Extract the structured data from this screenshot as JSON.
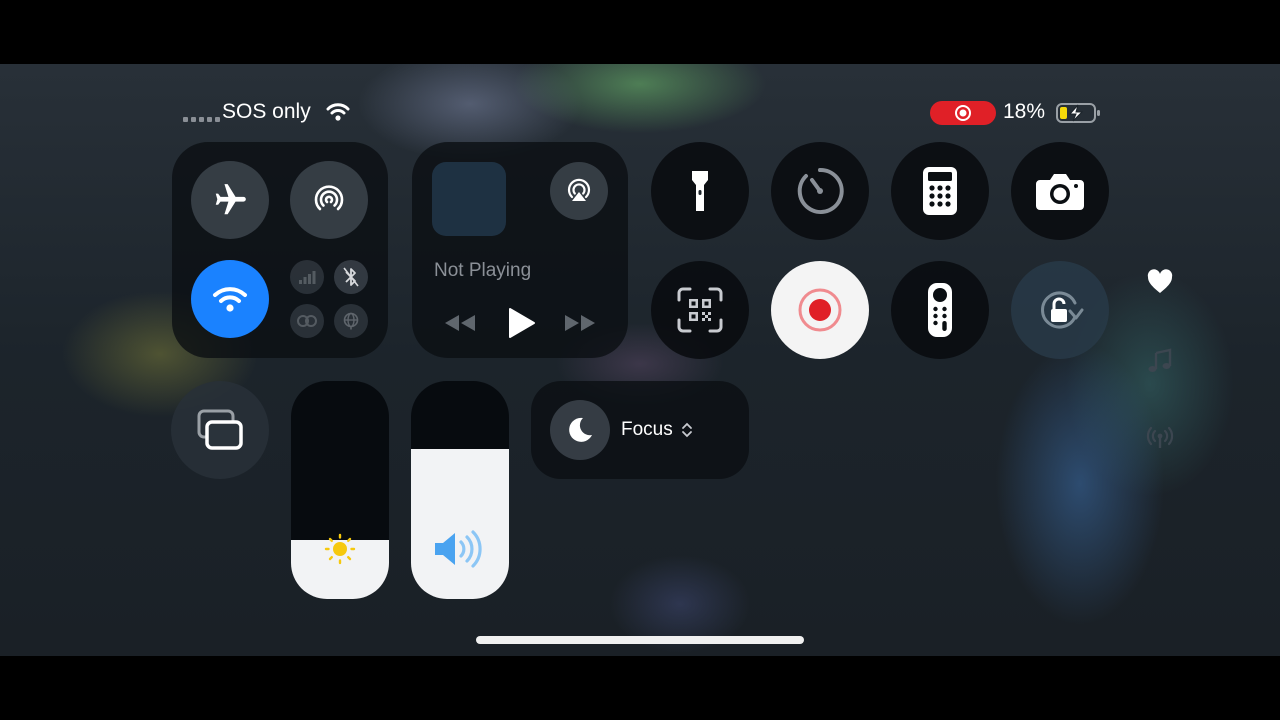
{
  "status_bar": {
    "carrier": "SOS only",
    "battery_percent": "18%",
    "battery_level": 0.18,
    "recording_active": true
  },
  "connectivity": {
    "airplane_mode": false,
    "airdrop": false,
    "wifi": true,
    "cellular": false,
    "bluetooth": false,
    "personal_hotspot": false,
    "vpn": false
  },
  "media": {
    "now_playing": "Not Playing"
  },
  "focus": {
    "label": "Focus"
  },
  "brightness_level": 0.27,
  "volume_level": 0.69,
  "icons": {
    "airplane": "airplane-icon",
    "airdrop": "airdrop-icon",
    "wifi": "wifi-icon",
    "cellular": "cellular-icon",
    "bluetooth": "bluetooth-icon",
    "hotspot": "hotspot-icon",
    "vpn": "vpn-globe-icon",
    "airplay": "airplay-icon",
    "flashlight": "flashlight-icon",
    "timer": "timer-icon",
    "calculator": "calculator-icon",
    "camera": "camera-icon",
    "qr": "qr-scanner-icon",
    "screen_record": "screen-record-icon",
    "remote": "apple-tv-remote-icon",
    "rotation_lock": "rotation-lock-icon",
    "screen_mirroring": "screen-mirroring-icon",
    "moon": "moon-icon",
    "sun": "sun-icon",
    "speaker": "speaker-icon",
    "heart": "heart-icon",
    "music": "music-note-icon",
    "antenna": "antenna-icon"
  },
  "colors": {
    "wifi_active": "#1a82ff",
    "record_red": "#e02027",
    "battery_yellow": "#f5d90a",
    "brightness_sun": "#f6c90e",
    "volume_blue": "#4aa3f0"
  }
}
